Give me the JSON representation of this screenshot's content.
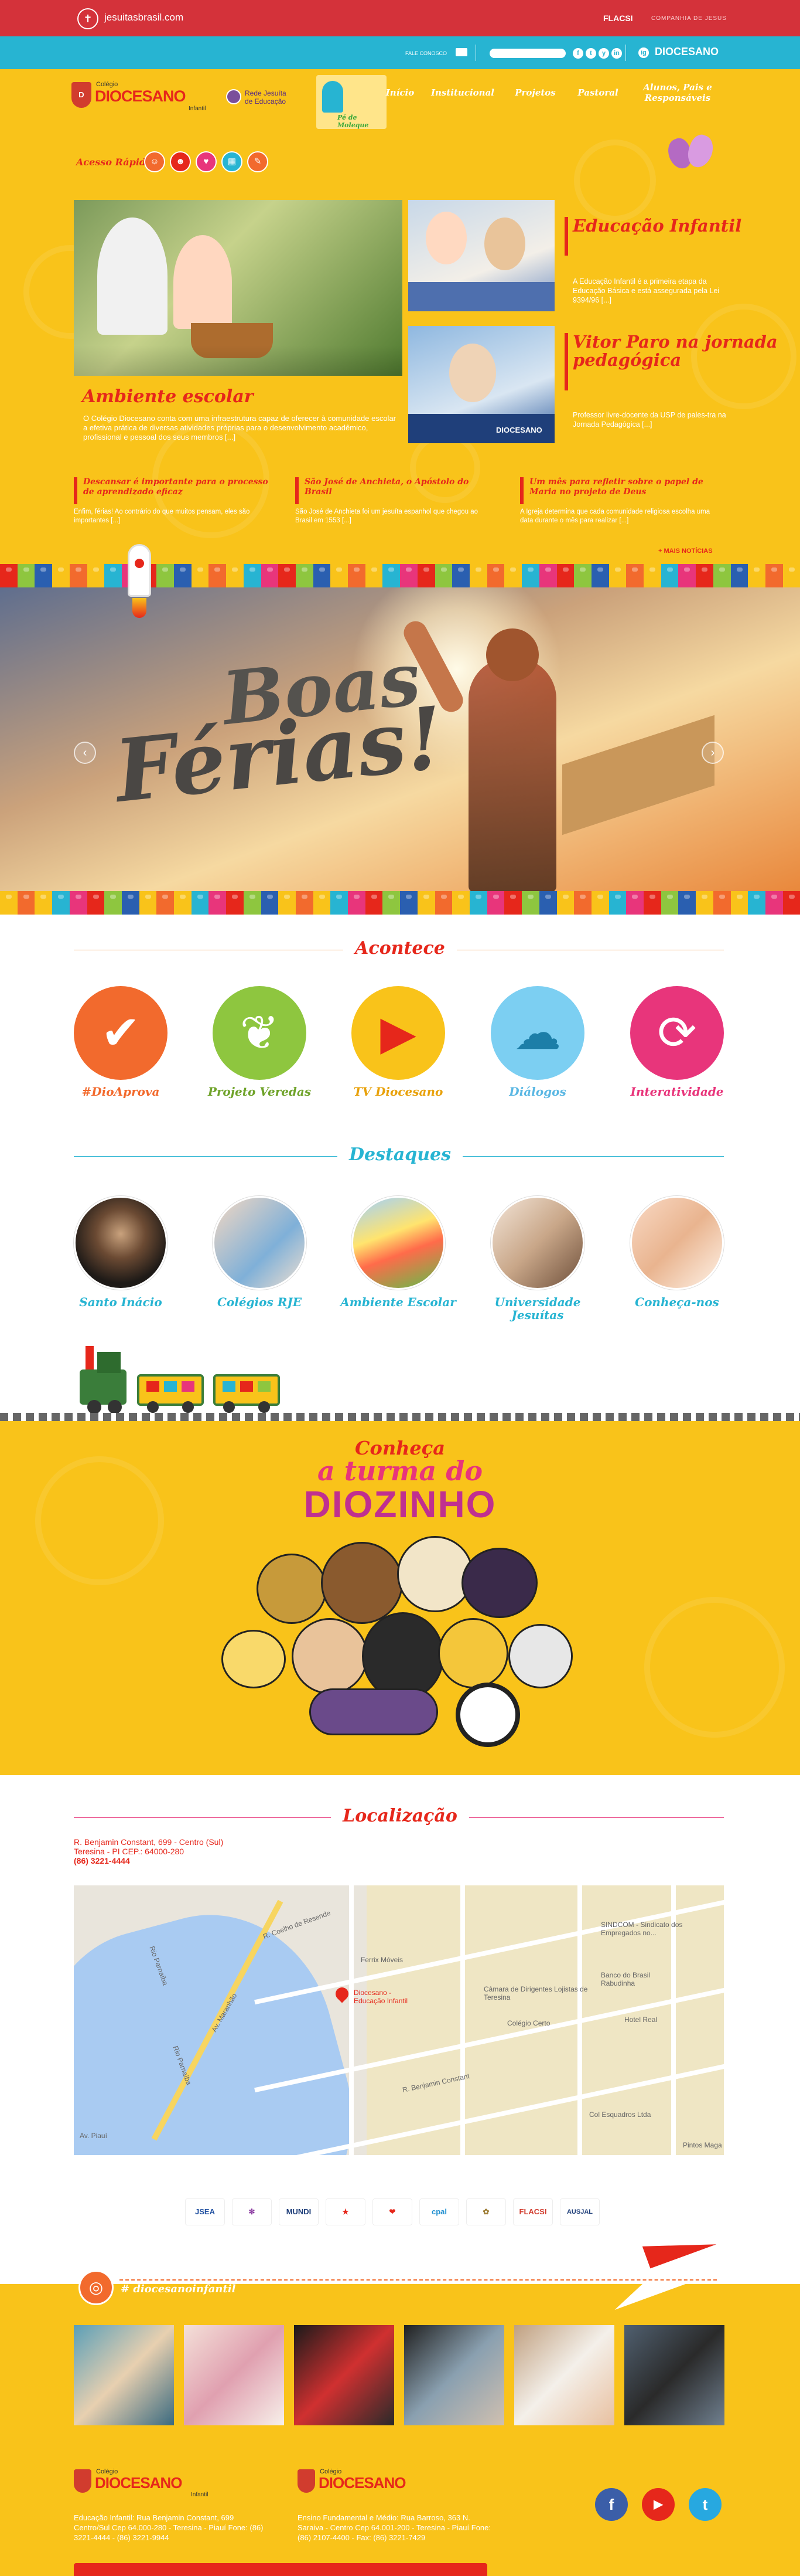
{
  "topbar": {
    "site": "jesuitasbrasil.com",
    "flacsi": "FLACSI",
    "companhia": "COMPANHIA DE JESUS"
  },
  "contactbar": {
    "fale_conosco": "FALE CONOSCO",
    "search_placeholder": "",
    "social": [
      "f",
      "t",
      "y",
      "in",
      "ig"
    ],
    "brand": "DIOCESANO"
  },
  "logo": {
    "colegio": "Colégio",
    "name": "DIOCESANO",
    "infantil": "Infantil"
  },
  "rje": {
    "line1": "Rede Jesuíta",
    "line2": "de Educação"
  },
  "mascot_label": "Pé de Moleque",
  "nav": [
    {
      "label": "Início",
      "color": "#e6271b"
    },
    {
      "label": "Institucional",
      "color": "#f26a2d"
    },
    {
      "label": "Projetos",
      "color": "#e8357b"
    },
    {
      "label": "Pastoral",
      "color": "#27b4d2"
    },
    {
      "label": "Alunos, Pais e Responsáveis",
      "color": "#f26a2d"
    }
  ],
  "acesso_rapido": "Acesso Rápido",
  "quick_icons": [
    "user-icon",
    "group-icon",
    "family-icon",
    "calendar-icon",
    "pencil-icon"
  ],
  "featured": {
    "main": {
      "title": "Ambiente escolar",
      "text": "O Colégio Diocesano conta com uma infraestrutura capaz de oferecer à comunidade escolar a efetiva prática de diversas atividades próprias para o desenvolvimento acadêmico, profissional e pessoal dos seus membros [...]"
    },
    "side1": {
      "title": "Educação Infantil",
      "text": "A Educação Infantil é a primeira etapa da Educação Básica e está assegurada pela Lei 9394/96 [...]"
    },
    "side2": {
      "title": "Vitor Paro na jornada pedagógica",
      "text": "Professor livre-docente da USP de pales-tra na Jornada Pedagógica [...]"
    },
    "side2_overlay": "DIOCESANO"
  },
  "news": [
    {
      "title": "Descansar é importante para o processo de aprendizado eficaz",
      "text": "Enfim, férias! Ao contrário do que muitos pensam, eles são importantes [...]"
    },
    {
      "title": "São José de Anchieta, o Apóstolo do Brasil",
      "text": "São José de Anchieta foi um jesuíta espanhol que chegou ao Brasil em 1553 [...]"
    },
    {
      "title": "Um mês para refletir sobre o papel de Maria no projeto de Deus",
      "text": "A Igreja determina que cada comunidade religiosa escolha uma data durante o mês para realizar [...]"
    }
  ],
  "mais_noticias": "+ MAIS NOTÍCIAS",
  "hero": {
    "line1": "Boas",
    "line2": "Férias!",
    "prev": "‹",
    "next": "›"
  },
  "acontece": {
    "title": "Acontece",
    "items": [
      {
        "label": "#DioAprova",
        "color": "#f26a2d",
        "glyph": "✔"
      },
      {
        "label": "Projeto Veredas",
        "color": "#8ec63f",
        "glyph": "❦"
      },
      {
        "label": "TV Diocesano",
        "color": "#f9c31a",
        "glyph": "▶"
      },
      {
        "label": "Diálogos",
        "color": "#7ccff2",
        "glyph": "☁"
      },
      {
        "label": "Interatividade",
        "color": "#e8357b",
        "glyph": "⟳"
      }
    ]
  },
  "destaques": {
    "title": "Destaques",
    "items": [
      {
        "label": "Santo Inácio"
      },
      {
        "label": "Colégios RJE"
      },
      {
        "label": "Ambiente Escolar"
      },
      {
        "label": "Universidade Jesuítas"
      },
      {
        "label": "Conheça-nos"
      }
    ]
  },
  "turma": {
    "l1": "Conheça",
    "l2": "a turma do",
    "l3": "DIOZINHO"
  },
  "localizacao": {
    "title": "Localização",
    "address": "R. Benjamin Constant, 699 - Centro (Sul)",
    "city": "Teresina - PI     CEP.: 64000-280",
    "phone": "(86) 3221-4444",
    "map_labels": [
      "Rio Parnaíba",
      "Ferrix Móveis",
      "Diocesano - Educação Infantil",
      "Câmara de Dirigentes Lojistas de Teresina",
      "Colégio Certo",
      "SINDCOM - Sindicato dos Empregados no...",
      "Banco do Brasil Rabudinha",
      "Hotel Real",
      "Col Esquadros Ltda",
      "Pintos Maga",
      "Av. Maranhão",
      "Av. Piauí",
      "R. Coelho de Resende",
      "R. Benjamin Constant"
    ]
  },
  "partners": [
    "JSEA",
    "✻",
    "MUNDI",
    "★",
    "❤",
    "cpal",
    "✿",
    "FLACSI",
    "AUSJAL"
  ],
  "instagram": {
    "hashtag": "# diocesanoinfantil",
    "photos": 6
  },
  "footer": {
    "infantil": {
      "colegio": "Colégio",
      "name": "DIOCESANO",
      "sub": "Infantil",
      "text": "Educação Infantil: Rua Benjamin Constant, 699 Centro/Sul Cep 64.000-280 - Teresina - Piauí Fone: (86) 3221-4444 - (86) 3221-9944"
    },
    "fundamental": {
      "colegio": "Colégio",
      "name": "DIOCESANO",
      "text": "Ensino Fundamental e Médio: Rua Barroso, 363 N. Saraiva - Centro Cep 64.001-200 - Teresina - Piauí Fone: (86) 2107-4400 - Fax: (86) 3221-7429"
    },
    "social": [
      {
        "glyph": "f",
        "color": "#3b5ea8"
      },
      {
        "glyph": "▶",
        "color": "#e6271b"
      },
      {
        "glyph": "t",
        "color": "#27a8e0"
      }
    ]
  },
  "colors": {
    "red": "#e6271b",
    "yellow": "#f9c31a",
    "cyan": "#27b4d2",
    "pink": "#e8357b",
    "orange": "#f26a2d",
    "green": "#8ec63f"
  }
}
